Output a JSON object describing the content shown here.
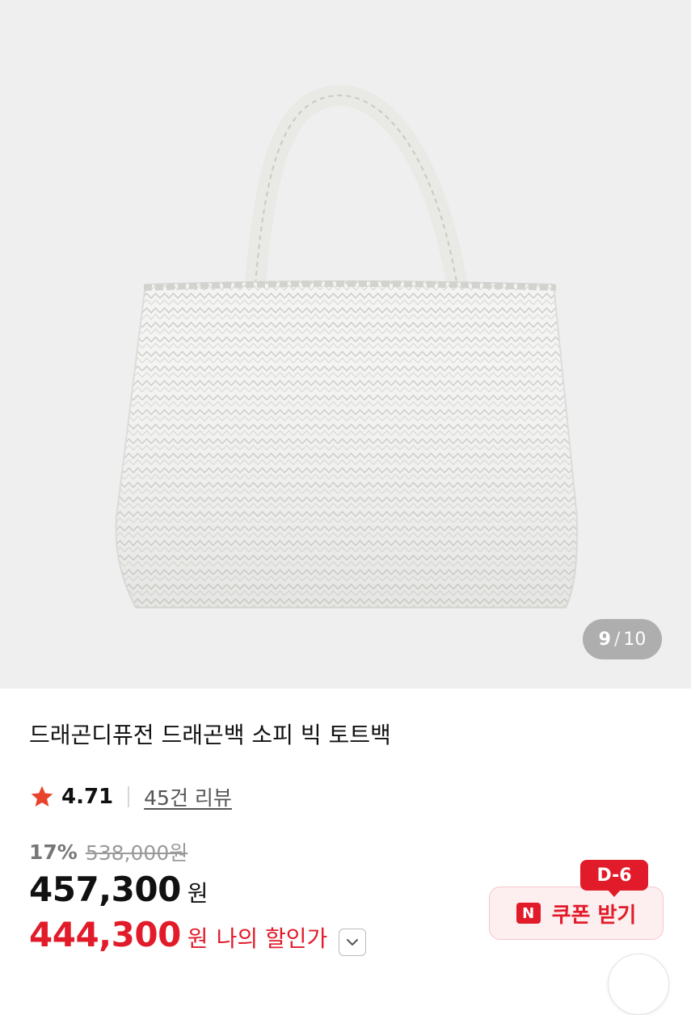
{
  "gallery": {
    "current_index": "9",
    "separator": "/",
    "total": "10",
    "image_alt": "white woven leather tote bag"
  },
  "product": {
    "title": "드래곤디퓨전 드래곤백 소피 빅 토트백",
    "rating": "4.71",
    "review_link": "45건 리뷰",
    "discount_percent": "17%",
    "original_price": "538,000원",
    "price": "457,300",
    "price_unit": "원",
    "my_price": "444,300",
    "my_price_unit": "원",
    "my_price_label": "나의 할인가"
  },
  "coupon": {
    "dday": "D-6",
    "badge": "N",
    "label": "쿠폰 받기"
  },
  "colors": {
    "accent_red": "#e21b2a",
    "star": "#e8442d",
    "gallery_bg": "#efeff0"
  },
  "icons": [
    "star-icon",
    "chevron-down-icon",
    "n-badge-icon"
  ]
}
